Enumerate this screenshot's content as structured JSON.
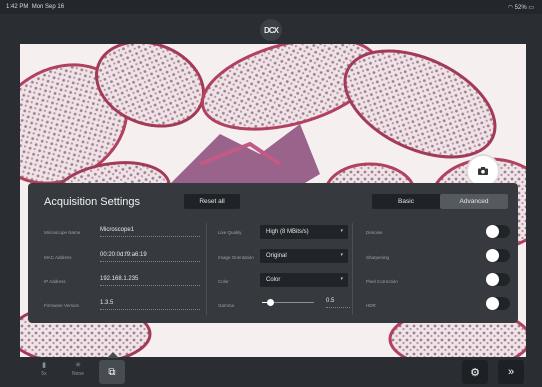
{
  "status": {
    "time": "1:42 PM",
    "date": "Mon Sep 16",
    "battery": "52%",
    "wifi_icon": "wifi-icon",
    "battery_icon": "battery-icon"
  },
  "top": {
    "logo_text": "DCX",
    "logo_icon": "brand-logo"
  },
  "panel": {
    "title": "Acquisition Settings",
    "reset_label": "Reset all",
    "mode_basic": "Basic",
    "mode_advanced": "Advanced",
    "active_mode": "Advanced"
  },
  "info": [
    {
      "label": "Microscope Name",
      "value": "Microscope1"
    },
    {
      "label": "MAC Address",
      "value": "00:20:0d:f9:a6:19"
    },
    {
      "label": "IP Address",
      "value": "192.168.1.235"
    },
    {
      "label": "Firmware Version",
      "value": "1.3.5"
    }
  ],
  "settings": {
    "live_quality": {
      "label": "Live Quality",
      "value": "High (8 MBits/s)"
    },
    "image_orientation": {
      "label": "Image Orientation",
      "value": "Original"
    },
    "color": {
      "label": "Color",
      "value": "Color"
    },
    "gamma": {
      "label": "Gamma",
      "value": "0.5",
      "level": 0.15
    }
  },
  "toggles": [
    {
      "label": "Denoise",
      "on": false
    },
    {
      "label": "Sharpening",
      "on": false
    },
    {
      "label": "Pixel Correction",
      "on": false
    },
    {
      "label": "HDR",
      "on": false
    }
  ],
  "bottom": {
    "item1_label": "5x",
    "item2_label": "None",
    "multi_icon": "multi-image-icon",
    "settings_icon": "gear-icon",
    "collapse_icon": "double-chevron-down-icon"
  },
  "colors": {
    "panel": "#363a3f",
    "toolbar": "#2a2e33",
    "accent": "#ffffff"
  }
}
